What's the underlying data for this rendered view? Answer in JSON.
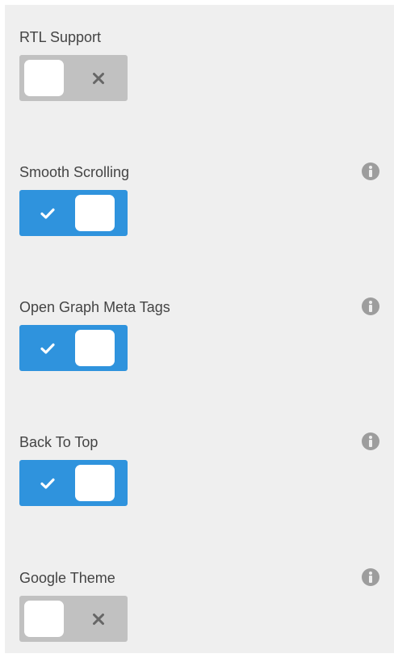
{
  "colors": {
    "toggle_on": "#2f93dd",
    "toggle_off": "#c1c1c1",
    "panel_background": "#efefef",
    "label_text": "#444444",
    "info_icon": "#9d9d9d"
  },
  "settings": [
    {
      "label": "RTL Support",
      "enabled": false,
      "has_info": false,
      "toggle_icon": "x-icon"
    },
    {
      "label": "Smooth Scrolling",
      "enabled": true,
      "has_info": true,
      "toggle_icon": "check-icon"
    },
    {
      "label": "Open Graph Meta Tags",
      "enabled": true,
      "has_info": true,
      "toggle_icon": "check-icon"
    },
    {
      "label": "Back To Top",
      "enabled": true,
      "has_info": true,
      "toggle_icon": "check-icon"
    },
    {
      "label": "Google Theme",
      "enabled": false,
      "has_info": true,
      "toggle_icon": "x-icon"
    }
  ]
}
